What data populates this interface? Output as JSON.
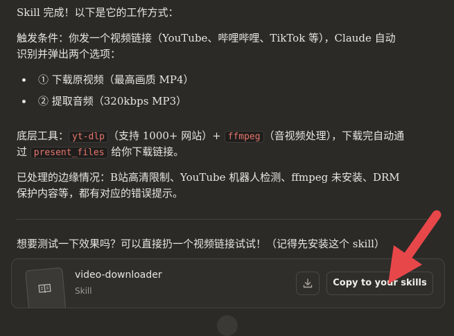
{
  "message": {
    "line1": "Skill 完成！以下是它的工作方式：",
    "trigger": {
      "line_a": "触发条件：你发一个视频链接（YouTube、哔哩哔哩、TikTok 等），Claude 自动",
      "line_b": "识别并弹出两个选项："
    },
    "options": [
      "① 下载原视频（最高画质 MP4）",
      "② 提取音频（320kbps MP3）"
    ],
    "tools": {
      "prefix": "底层工具：",
      "code1": "yt-dlp",
      "mid1": "（支持 1000+ 网站）+ ",
      "code2": "ffmpeg",
      "mid2": "（音视频处理），下载完自动通",
      "line2_prefix": "过 ",
      "code3": "present_files",
      "line2_suffix": " 给你下载链接。"
    },
    "edge": {
      "line_a": "已处理的边缘情况：B站高清限制、YouTube 机器人检测、ffmpeg 未安装、DRM",
      "line_b": "保护内容等，都有对应的错误提示。"
    },
    "test_prompt": "想要测试一下效果吗？可以直接扔一个视频链接试试！（记得先安装这个 skill）"
  },
  "skill_card": {
    "name": "video-downloader",
    "type": "Skill",
    "copy_label": "Copy to your skills",
    "icon": "book-icon",
    "download_icon": "download-icon"
  },
  "colors": {
    "background": "#2b2a27",
    "code_text": "#e8766d",
    "annotation_arrow": "#e8474a"
  }
}
